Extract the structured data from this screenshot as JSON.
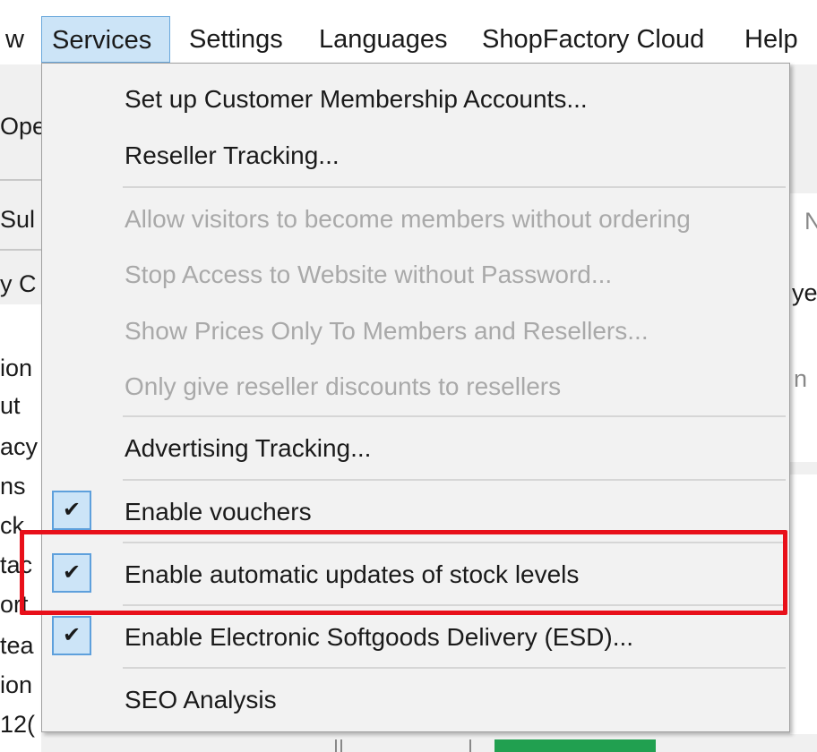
{
  "menubar": {
    "items": [
      {
        "label": "w"
      },
      {
        "label": "Services"
      },
      {
        "label": "Settings"
      },
      {
        "label": "Languages"
      },
      {
        "label": "ShopFactory Cloud"
      },
      {
        "label": "Help"
      }
    ]
  },
  "background": {
    "fragments": [
      "Ope",
      "Sul",
      "y C",
      "ion",
      "ut",
      "acy",
      "ns",
      "ck",
      "tac",
      "ort",
      "tea",
      "ion",
      "12(",
      "N",
      "ye",
      "n"
    ]
  },
  "menu": {
    "items": [
      {
        "label": "Set up Customer Membership Accounts...",
        "enabled": true
      },
      {
        "label": "Reseller Tracking...",
        "enabled": true
      },
      {
        "label": "Allow visitors to become members without ordering",
        "enabled": false
      },
      {
        "label": "Stop Access to Website without Password...",
        "enabled": false
      },
      {
        "label": "Show Prices Only To Members and Resellers...",
        "enabled": false
      },
      {
        "label": "Only give reseller discounts to resellers",
        "enabled": false
      },
      {
        "label": "Advertising Tracking...",
        "enabled": true
      },
      {
        "label": "Enable vouchers",
        "enabled": true,
        "checked": true
      },
      {
        "label": "Enable automatic updates of stock levels",
        "enabled": true,
        "checked": true
      },
      {
        "label": "Enable Electronic Softgoods Delivery (ESD)...",
        "enabled": true,
        "checked": true
      },
      {
        "label": "SEO Analysis",
        "enabled": true
      }
    ],
    "check_glyph": "✔"
  },
  "colors": {
    "highlight_border": "#e8101a",
    "active_menu_bg": "#cce4f7",
    "disabled_text": "#a9a9a9"
  }
}
